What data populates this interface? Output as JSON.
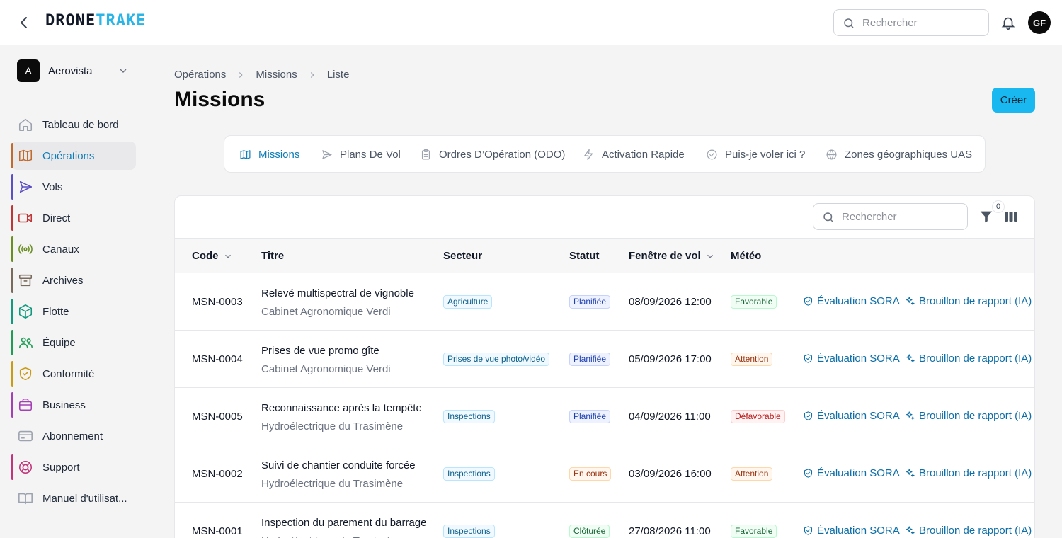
{
  "app": {
    "logo_part1": "DRONE",
    "logo_part2": "TRAKE"
  },
  "header": {
    "search_placeholder": "Rechercher",
    "avatar_initials": "GF"
  },
  "org": {
    "badge": "A",
    "name": "Aerovista"
  },
  "sidebar": {
    "items": [
      {
        "label": "Tableau de bord",
        "icon": "home-icon",
        "color": "#9ca3af",
        "bar": ""
      },
      {
        "label": "Opérations",
        "icon": "map-icon",
        "color": "#c2692e",
        "bar": "#c2692e",
        "active": true
      },
      {
        "label": "Vols",
        "icon": "send-icon",
        "color": "#5b4fc4",
        "bar": "#5b4fc4"
      },
      {
        "label": "Direct",
        "icon": "video-icon",
        "color": "#c03535",
        "bar": "#c03535"
      },
      {
        "label": "Canaux",
        "icon": "radio-icon",
        "color": "#6b8e23",
        "bar": "#6b8e23"
      },
      {
        "label": "Archives",
        "icon": "archive-icon",
        "color": "#7a6a5c",
        "bar": "#7a6a5c"
      },
      {
        "label": "Flotte",
        "icon": "box-icon",
        "color": "#119a7e",
        "bar": "#119a7e"
      },
      {
        "label": "Équipe",
        "icon": "users-icon",
        "color": "#1f9d55",
        "bar": "#1f9d55"
      },
      {
        "label": "Conformité",
        "icon": "shield-icon",
        "color": "#c99b12",
        "bar": "#c99b12"
      },
      {
        "label": "Business",
        "icon": "briefcase-icon",
        "color": "#a43fb5",
        "bar": "#a43fb5"
      },
      {
        "label": "Abonnement",
        "icon": "card-icon",
        "color": "#9ca3af",
        "bar": ""
      },
      {
        "label": "Support",
        "icon": "lifebuoy-icon",
        "color": "#c2357a",
        "bar": "#c2357a"
      },
      {
        "label": "Manuel d'utilisat...",
        "icon": "book-icon",
        "color": "#9ca3af",
        "bar": ""
      }
    ]
  },
  "breadcrumb": [
    "Opérations",
    "Missions",
    "Liste"
  ],
  "page": {
    "title": "Missions",
    "create_label": "Créer"
  },
  "tabs": [
    {
      "label": "Missions",
      "icon": "map-icon",
      "active": true
    },
    {
      "label": "Plans De Vol",
      "icon": "send-icon"
    },
    {
      "label": "Ordres D’Opération (ODO)",
      "icon": "clipboard-icon"
    },
    {
      "label": "Activation Rapide",
      "icon": "zap-icon"
    },
    {
      "label": "Puis-je voler ici ?",
      "icon": "check-circle-icon"
    },
    {
      "label": "Zones géographiques UAS",
      "icon": "globe-icon"
    }
  ],
  "table": {
    "search_placeholder": "Rechercher",
    "filter_count": "0",
    "columns": {
      "code": "Code",
      "title": "Titre",
      "sector": "Secteur",
      "status": "Statut",
      "window": "Fenêtre de vol",
      "weather": "Météo"
    },
    "action_sora": "Évaluation SORA",
    "action_report": "Brouillon de rapport (IA)",
    "rows": [
      {
        "code": "MSN-0003",
        "title": "Relevé multispectral de vignoble",
        "client": "Cabinet Agronomique Verdi",
        "sector": "Agriculture",
        "status": "Planifiée",
        "status_kind": "plan",
        "window": "08/09/2026 12:00",
        "weather": "Favorable",
        "weather_kind": "fav"
      },
      {
        "code": "MSN-0004",
        "title": "Prises de vue promo gîte",
        "client": "Cabinet Agronomique Verdi",
        "sector": "Prises de vue photo/vidéo",
        "status": "Planifiée",
        "status_kind": "plan",
        "window": "05/09/2026 17:00",
        "weather": "Attention",
        "weather_kind": "att"
      },
      {
        "code": "MSN-0005",
        "title": "Reconnaissance après la tempête",
        "client": "Hydroélectrique du Trasimène",
        "sector": "Inspections",
        "status": "Planifiée",
        "status_kind": "plan",
        "window": "04/09/2026 11:00",
        "weather": "Défavorable",
        "weather_kind": "def"
      },
      {
        "code": "MSN-0002",
        "title": "Suivi de chantier conduite forcée",
        "client": "Hydroélectrique du Trasimène",
        "sector": "Inspections",
        "status": "En cours",
        "status_kind": "cours",
        "window": "03/09/2026 16:00",
        "weather": "Attention",
        "weather_kind": "att"
      },
      {
        "code": "MSN-0001",
        "title": "Inspection du parement du barrage",
        "client": "Hydroélectrique du Trasimène",
        "sector": "Inspections",
        "status": "Clôturée",
        "status_kind": "clot",
        "window": "27/08/2026 11:00",
        "weather": "Favorable",
        "weather_kind": "fav"
      }
    ]
  }
}
